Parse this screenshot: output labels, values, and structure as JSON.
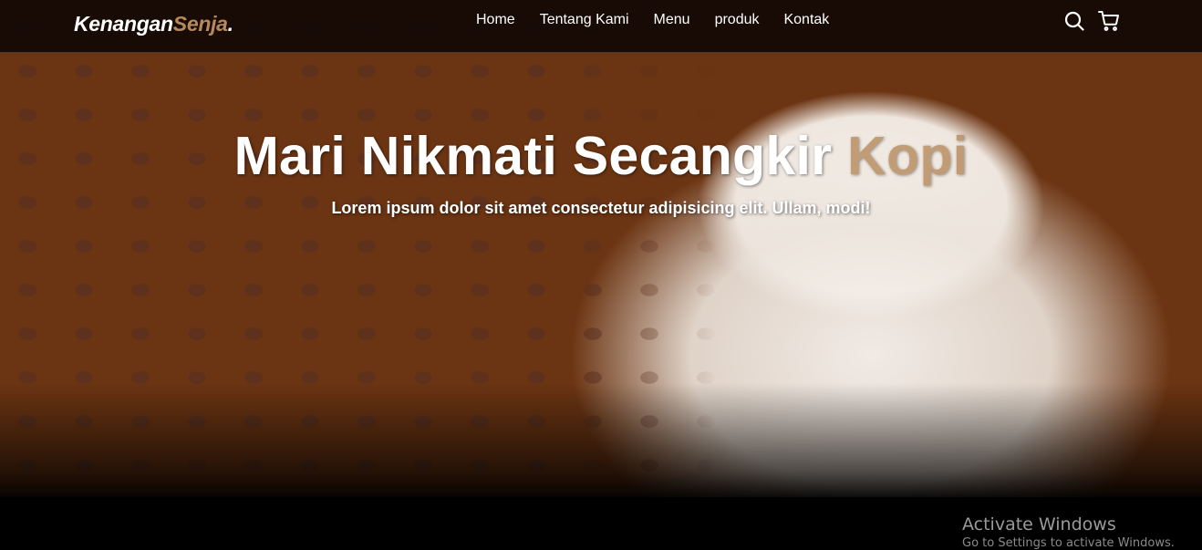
{
  "brand": {
    "name_main": "Kenangan",
    "name_accent": "Senja",
    "name_dot": ".",
    "accent_color": "#b6895b"
  },
  "nav": {
    "links": [
      "Home",
      "Tentang Kami",
      "Menu",
      "produk",
      "Kontak"
    ],
    "icons": [
      "search-icon",
      "shopping-cart-icon"
    ]
  },
  "hero": {
    "title_main": "Mari Nikmati Secangkir ",
    "title_accent": "Kopi",
    "subtitle": "Lorem ipsum dolor sit amet consectetur adipisicing elit. Ullam, modi!",
    "background_image": "coffee-cup-and-beans"
  },
  "watermark": {
    "title": "Activate Windows",
    "subtitle": "Go to Settings to activate Windows."
  }
}
